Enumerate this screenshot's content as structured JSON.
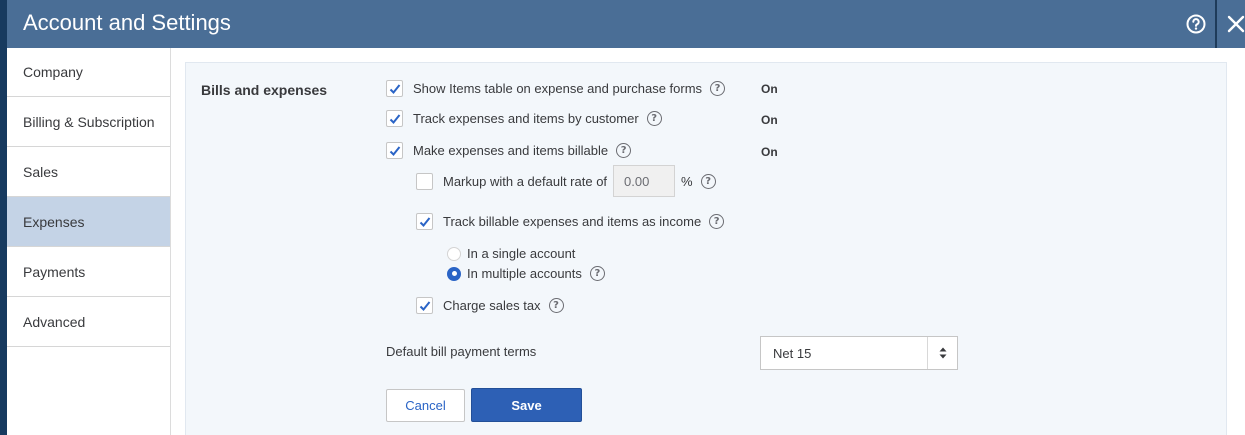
{
  "window": {
    "title": "Account and Settings",
    "help_icon": "help-circle-icon",
    "close_icon": "close-icon"
  },
  "sidebar": {
    "items": [
      {
        "label": "Company",
        "active": false
      },
      {
        "label": "Billing & Subscription",
        "active": false
      },
      {
        "label": "Sales",
        "active": false
      },
      {
        "label": "Expenses",
        "active": true
      },
      {
        "label": "Payments",
        "active": false
      },
      {
        "label": "Advanced",
        "active": false
      }
    ]
  },
  "section": {
    "title": "Bills and expenses",
    "show_items_table": {
      "label": "Show Items table on expense and purchase forms",
      "checked": true,
      "status": "On"
    },
    "track_by_customer": {
      "label": "Track expenses and items by customer",
      "checked": true,
      "status": "On"
    },
    "make_billable": {
      "label": "Make expenses and items billable",
      "checked": true,
      "status": "On"
    },
    "markup": {
      "label": "Markup with a default rate of",
      "checked": false,
      "value": "0.00",
      "unit": "%"
    },
    "track_as_income": {
      "label": "Track billable expenses and items as income",
      "checked": true
    },
    "income_account": {
      "options": [
        {
          "label": "In a single account",
          "selected": false
        },
        {
          "label": "In multiple accounts",
          "selected": true
        }
      ]
    },
    "charge_sales_tax": {
      "label": "Charge sales tax",
      "checked": true
    },
    "payment_terms": {
      "label": "Default bill payment terms",
      "value": "Net 15"
    }
  },
  "actions": {
    "cancel_label": "Cancel",
    "save_label": "Save"
  },
  "colors": {
    "titlebar": "#4a6e96",
    "accent": "#2a64c6",
    "save_button": "#2d60b5",
    "active_nav": "#c4d3e6"
  }
}
